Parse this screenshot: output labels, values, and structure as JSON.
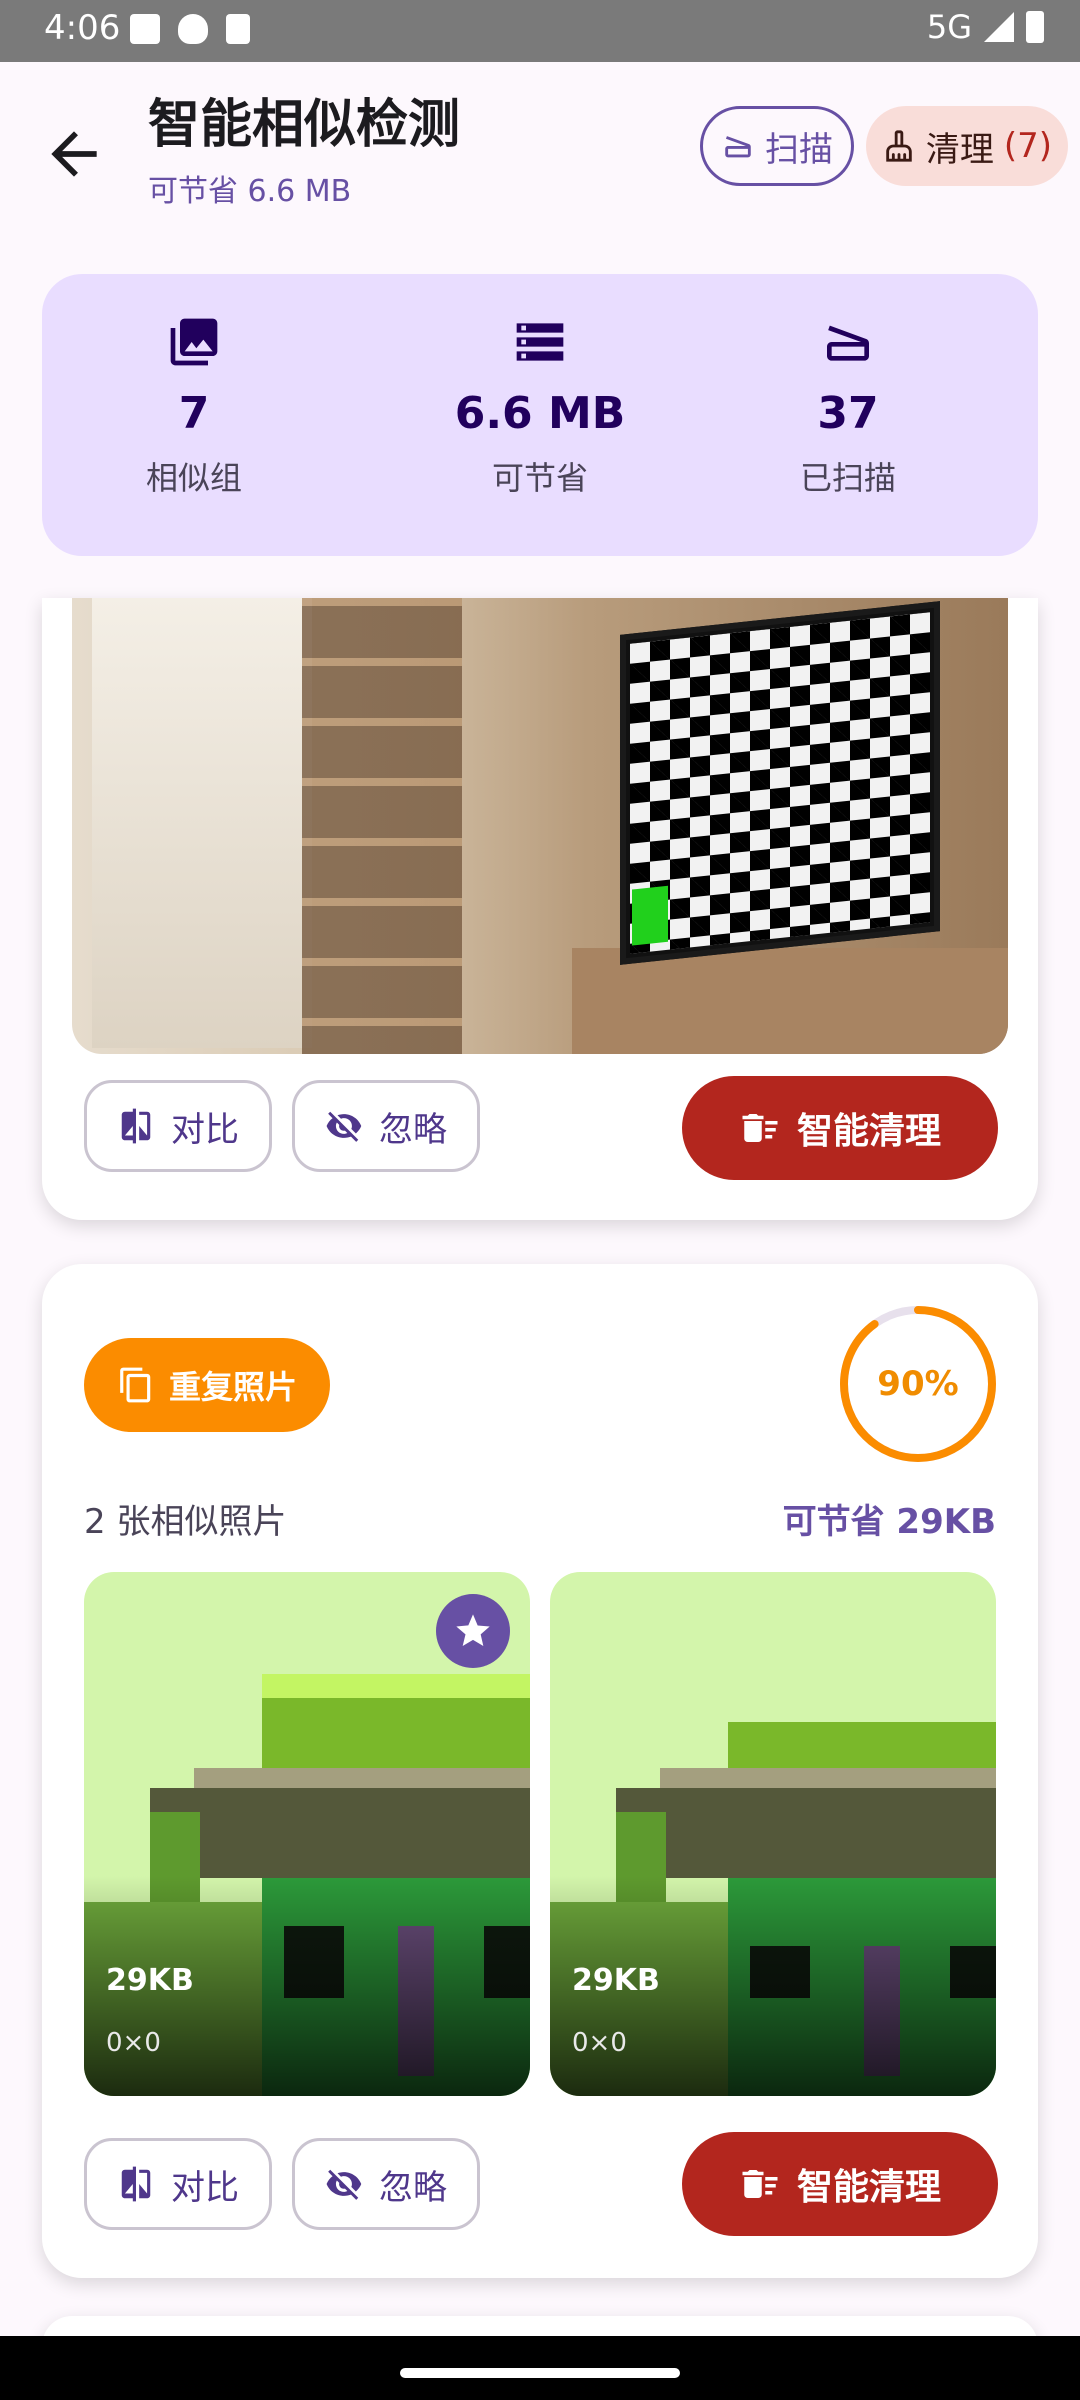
{
  "status_bar": {
    "time": "4:06",
    "network": "5G"
  },
  "header": {
    "title": "智能相似检测",
    "subtitle": "可节省 6.6 MB",
    "scan_label": "扫描",
    "clean_label": "清理",
    "clean_count": "(7)"
  },
  "stats": [
    {
      "icon": "photo-library-icon",
      "value": "7",
      "label": "相似组"
    },
    {
      "icon": "storage-icon",
      "value": "6.6 MB",
      "label": "可节省"
    },
    {
      "icon": "scanner-icon",
      "value": "37",
      "label": "已扫描"
    }
  ],
  "card1": {
    "compare_label": "对比",
    "ignore_label": "忽略",
    "smart_clean_label": "智能清理"
  },
  "card2": {
    "badge_label": "重复照片",
    "similarity_text": "90%",
    "similarity_fraction": 0.9,
    "count_text": "2 张相似照片",
    "save_text": "可节省 29KB",
    "photos": [
      {
        "size": "29KB",
        "dims": "0×0",
        "recommended": true
      },
      {
        "size": "29KB",
        "dims": "0×0",
        "recommended": false
      }
    ],
    "compare_label": "对比",
    "ignore_label": "忽略",
    "smart_clean_label": "智能清理"
  },
  "colors": {
    "primary": "#6750a4",
    "danger": "#b3261e",
    "accent_orange": "#fb8c00",
    "stats_bg": "#e9ddff"
  }
}
